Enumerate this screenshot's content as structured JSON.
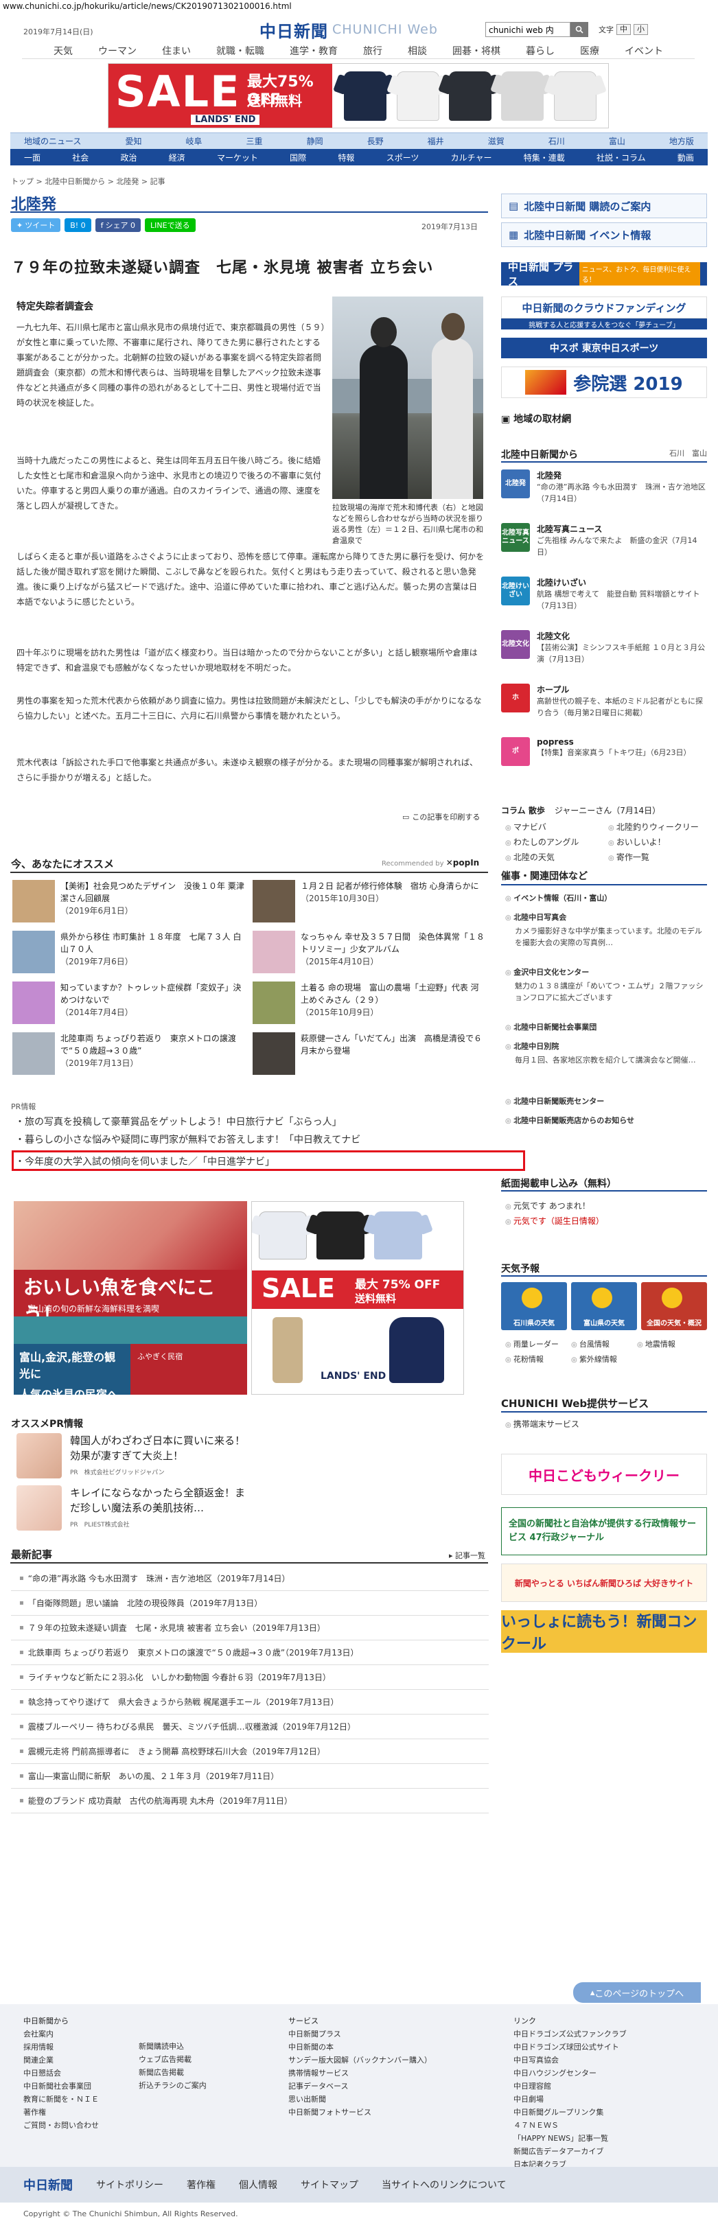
{
  "url": "www.chunichi.co.jp/hokuriku/article/news/CK2019071302100016.html",
  "header": {
    "date": "2019年7月14日(日)",
    "logo_main": "中日新聞",
    "logo_sub": "CHUNICHI Web",
    "search_value": "chunichi web 内",
    "font_label": "文字",
    "font_mid": "中",
    "font_small": "小"
  },
  "topnav": [
    "天気",
    "ウーマン",
    "住まい",
    "就職・転職",
    "進学・教育",
    "旅行",
    "相談",
    "囲碁・将棋",
    "暮らし",
    "医療",
    "イベント"
  ],
  "topad": {
    "sale": "SALE",
    "off": "最大75% OFF",
    "free": "送料無料",
    "brand": "LANDS' END"
  },
  "catnav1": [
    "地域のニュース",
    "愛知",
    "岐阜",
    "三重",
    "静岡",
    "長野",
    "福井",
    "滋賀",
    "石川",
    "富山",
    "地方版"
  ],
  "catnav2": [
    "一面",
    "社会",
    "政治",
    "経済",
    "マーケット",
    "国際",
    "特報",
    "スポーツ",
    "カルチャー",
    "特集・連載",
    "社説・コラム",
    "動画"
  ],
  "breadcrumb": "トップ > 北陸中日新聞から > 北陸発 > 記事",
  "section_title": "北陸発",
  "share": {
    "tweet": "ツイート",
    "hatena": "B! 0",
    "fb": "シェア 0",
    "line": "LINEで送る"
  },
  "article": {
    "date": "2019年7月13日",
    "headline": "７９年の拉致未遂疑い調査　七尾・氷見境 被害者 立ち会い",
    "subhead": "特定失踪者調査会",
    "paragraphs": [
      "一九七九年、石川県七尾市と富山県氷見市の県境付近で、東京都職員の男性（５９）が女性と車に乗っていた際、不審車に尾行され、降りてきた男に暴行されたとする事案があることが分かった。北朝鮮の拉致の疑いがある事案を調べる特定失踪者問題調査会（東京都）の荒木和博代表らは、当時現場を目撃したアベック拉致未遂事件などと共通点が多く同種の事件の恐れがあるとして十二日、男性と現場付近で当時の状況を検証した。",
      "当時十九歳だったこの男性によると、発生は同年五月五日午後八時ごろ。後に結婚した女性と七尾市和倉温泉へ向かう途中、氷見市との境辺りで後ろの不審車に気付いた。停車すると男四人乗りの車が通過。白のスカイラインで、通過の際、速度を落とし四人が凝視してきた。",
      "しばらく走ると車が長い道路をふさぐように止まっており、恐怖を感じて停車。運転席から降りてきた男に暴行を受け、何かを話した後が聞き取れず窓を開けた瞬間、こぶしで鼻などを殴られた。気付くと男はもう走り去っていて、殺されると思い急発進。後に乗り上げながら猛スピードで逃げた。途中、沿道に停めていた車に拾われ、車ごと逃げ込んだ。襲った男の言葉は日本語でないように感じたという。",
      "四十年ぶりに現場を訪れた男性は「道が広く様変わり。当日は暗かったので分からないことが多い」と話し観察場所や倉庫は特定できず、和倉温泉でも感触がなくなったせいか現地取材を不明だった。",
      "男性の事案を知った荒木代表から依頼があり調査に協力。男性は拉致問題が未解決だとし、「少しでも解決の手がかりになるなら協力したい」と述べた。五月二十三日に、六月に石川県警から事情を聴かれたという。",
      "荒木代表は「訴訟された手口で他事案と共通点が多い。未遂ゆえ観察の様子が分かる。また現場の同種事案が解明されれば、さらに手掛かりが増える」と話した。"
    ],
    "caption": "拉致現場の海岸で荒木和博代表（右）と地図などを照らし合わせながら当時の状況を振り返る男性（左）＝１２日、石川県七尾市の和倉温泉で",
    "print": "この記事を印刷する"
  },
  "recommend": {
    "title": "今、あなたにオススメ",
    "by": "Recommended by",
    "items": [
      {
        "text": "【美術】社会見つめたデザイン　没後１０年 粟津潔さん回顧展",
        "date": "（2019年6月1日）"
      },
      {
        "text": "１月２日 記者が修行修体験　宿坊 心身清らかに",
        "date": "（2015年10月30日）"
      },
      {
        "text": "県外から移住 市町集計 １８年度　七尾７３人 白山７０人",
        "date": "（2019年7月6日）"
      },
      {
        "text": "なっちゃん 幸せ及３５７日間　染色体異常「１８トリソミー」少女アルバム",
        "date": "（2015年4月10日）"
      },
      {
        "text": "知っていますか？トゥレット症候群「変奴子」決めつけないで",
        "date": "（2014年7月4日）"
      },
      {
        "text": "土着る 命の現場　富山の農場「土迎野」代表 河上めぐみさん（２９）",
        "date": "（2015年10月9日）"
      },
      {
        "text": "北陸車両 ちょっぴり若返り　東京メトロの譲渡で“５０歳超→３０歳”",
        "date": "（2019年7月13日）"
      },
      {
        "text": "萩原健一さん「いだてん」出演　高橋是清役で６月末から登場",
        "date": ""
      }
    ]
  },
  "pr": {
    "label": "PR情報",
    "lines": [
      "・旅の写真を投稿して豪華賞品をゲットしよう！中日旅行ナビ「ぶらっ人」",
      "・暮らしの小さな悩みや疑問に専門家が無料でお答えします！「中日教えてナビ",
      "・今年度の大学入試の傾向を伺いました／「中日進学ナビ」"
    ]
  },
  "ad1": {
    "line1": "おいしい魚を食べにこう！",
    "line2": "富山湾の旬の新鮮な海鮮料理を満喫",
    "line3": "富山,金沢,能登の観光に",
    "line4": "人気の氷見の民宿へ ▶",
    "brand": "ふやぎく民宿"
  },
  "ad2": {
    "sale": "SALE",
    "off": "最大 75% OFF",
    "free": "送料無料",
    "brand": "LANDS' END"
  },
  "osusume": {
    "title": "オススメPR情報",
    "items": [
      {
        "text": "韓国人がわざわざ日本に買いに来る！効果が凄すぎて大炎上！",
        "by": "PR　株式会社ビグリッドジャパン"
      },
      {
        "text": "キレイにならなかったら全額返金！まだ珍しい魔法系の美肌技術…",
        "by": "PR　PLIEST株式会社"
      }
    ]
  },
  "latest": {
    "title": "最新記事",
    "more": "記事一覧",
    "items": [
      "“命の港”再氷路 今も水田潤す　珠洲・吉ケ池地区（2019年7月14日）",
      "「自衛隊問題」思い議論　北陸の現役隊員（2019年7月13日）",
      "７９年の拉致未遂疑い調査　七尾・氷見境 被害者 立ち会い（2019年7月13日）",
      "北鉄車両 ちょっぴり若返り　東京メトロの譲渡で“５０歳超→３０歳”（2019年7月13日）",
      "ライチャウなど新たに２羽ふ化　いしかわ動物園 今春計６羽（2019年7月13日）",
      "執念持ってやり遂げて　県大会きょうから熱戦 梶尾選手エール（2019年7月13日）",
      "震楼ブルーペリー 待ちわびる県民　曇天、ミツバチ低調…収穫激減（2019年7月12日）",
      "震槻元走将 門前高振導者に　きょう開幕 高校野球石川大会（2019年7月12日）",
      "富山―東富山間に新駅　あいの風、２１年３月（2019年7月11日）",
      "能登のブランド 成功貢献　古代の航海再現 丸木舟（2019年7月11日）"
    ]
  },
  "right": {
    "subscribe": "北陸中日新聞 購読のご案内",
    "events": "北陸中日新聞 イベント情報",
    "plus": "中日新聞 プラス",
    "plus_sub": "ニュース、おトク、毎日便利に使える！",
    "crowd": "中日新聞のクラウドファンディング",
    "crowd_sub": "挑戦する人と応援する人をつなぐ「夢チューブ」",
    "chudoku": "中スポ 東京中日スポーツ",
    "election": "参院選 2019",
    "bureau": "地域の取材網",
    "from_title": "北陸中日新聞から",
    "from_tabs": "石川　富山",
    "from_items": [
      {
        "icon": "北陸発",
        "title": "北陸発",
        "desc": "“命の港”再氷路 今も水田潤す　珠洲・吉ケ池地区（7月14日）",
        "color": "#3a6fb6"
      },
      {
        "icon": "北陸写真ニュース",
        "title": "北陸写真ニュース",
        "desc": "ご先祖様 みんなで来たよ　新盛の金沢（7月14日）",
        "color": "#2c7a3f"
      },
      {
        "icon": "北陸けいざい",
        "title": "北陸けいざい",
        "desc": "航路 構想で考えて　能登自動 質料増額とサイト（7月13日）",
        "color": "#1e8ac2"
      },
      {
        "icon": "北陸文化",
        "title": "北陸文化",
        "desc": "【芸術公演】ミシンフスキ手紙館 １０月と３月公演（7月13日）",
        "color": "#8b4c9e"
      },
      {
        "icon": "ホ",
        "title": "ホープル",
        "desc": "高齢世代の親子を、本紙のミドル記者がともに探り合う（毎月第2日曜日に掲載）",
        "color": "#d8262f"
      },
      {
        "icon": "ポ",
        "title": "popress",
        "desc": "【特集】音楽家真う「トキワ荘」（6月23日）",
        "color": "#e5478a"
      }
    ],
    "column_label": "コラム 散歩",
    "column_text": "ジャーニーさん（7月14日）",
    "links": [
      "マナビバ",
      "北陸釣りウィークリー",
      "わたしのアングル",
      "おいしいよ！",
      "北陸の天気",
      "寄作一覧"
    ],
    "events_title": "催事・関連団体など",
    "events_items": [
      {
        "title": "イベント情報（石川・富山）",
        "desc": ""
      },
      {
        "title": "北陸中日写真会",
        "desc": "カメラ撮影好きな中学が集まっています。北陸のモデルを撮影大会の実際の写真例…"
      },
      {
        "title": "金沢中日文化センター",
        "desc": "魅力の１３８講座が「めいてつ・エムザ」２階ファッションフロアに拡大ございます"
      },
      {
        "title": "北陸中日新聞社会事業団",
        "desc": ""
      },
      {
        "title": "北陸中日別院",
        "desc": "毎月１回、各家地区宗教を紹介して講演会など開催…"
      },
      {
        "title": "北陸中日新聞販売センター",
        "desc": ""
      },
      {
        "title": "北陸中日新聞販売店からのお知らせ",
        "desc": ""
      }
    ],
    "apply_title": "紙面掲載申し込み（無料）",
    "apply_items": [
      "元気です あつまれ！",
      "元気です（誕生日情報）"
    ],
    "weather_title": "天気予報",
    "weather_tiles": [
      "石川県の天気",
      "富山県の天気",
      "全国の天気・概況"
    ],
    "weather_links": [
      "雨量レーダー",
      "台風情報",
      "地震情報",
      "花粉情報",
      "紫外線情報"
    ],
    "services_title": "CHUNICHI Web提供サービス",
    "services_item": "携帯端末サービス",
    "kodomo": "中日こどもウィークリー",
    "gyosei": "全国の新聞社と自治体が提供する行政情報サービス 47行政ジャーナル",
    "hiroba": "新聞やっとる いちばん新聞ひろば 大好きサイト",
    "contest": "いっしょに読もう！新聞コンクール"
  },
  "footer": {
    "pagetop": "このページのトップへ",
    "col1_head": "中日新聞から",
    "col1": [
      "会社案内",
      "採用情報",
      "関連企業",
      "中日懇話会",
      "中日新聞社会事業団",
      "教育に新聞を・ＮＩＥ",
      "著作権",
      "ご質問・お問い合わせ"
    ],
    "col2": [
      "新聞購読申込",
      "ウェブ広告掲載",
      "新聞広告掲載",
      "折込チラシのご案内"
    ],
    "col3_head": "サービス",
    "col3": [
      "中日新聞プラス",
      "中日新聞の本",
      "サンデー版大図解（バックナンバー購入）",
      "携帯情報サービス",
      "記事データベース",
      "思い出新聞",
      "中日新聞フォトサービス"
    ],
    "col4_head": "リンク",
    "col4": [
      "中日ドラゴンズ公式ファンクラブ",
      "中日ドラゴンズ球団公式サイト",
      "中日写真協会",
      "中日ハウジングセンター",
      "中日理容館",
      "中日劇場",
      "中日新聞グループリンク集",
      "４７ＮＥＷＳ",
      "「HAPPY NEWS」記事一覧",
      "新聞広告データアーカイブ",
      "日本記者クラブ"
    ],
    "bar_logo": "中日新聞",
    "bar_links": [
      "サイトポリシー",
      "著作権",
      "個人情報",
      "サイトマップ",
      "当サイトへのリンクについて"
    ],
    "copyright": "Copyright © The Chunichi Shimbun, All Rights Reserved."
  }
}
